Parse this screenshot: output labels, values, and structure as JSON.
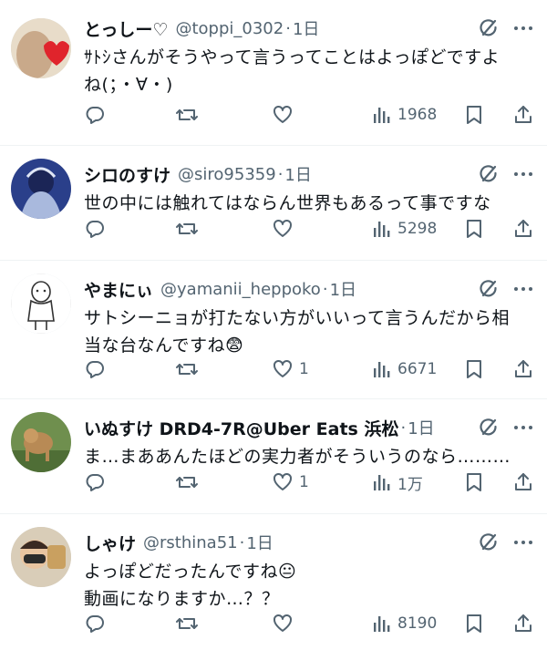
{
  "replies": [
    {
      "name": "とっしー♡",
      "handle": "@toppi_0302",
      "time": "1日",
      "text": "ｻﾄｼさんがそうやって言うってことはよっぽどですよ\nね(；・∀・)",
      "likes": "",
      "views": "1968"
    },
    {
      "name": "シロのすけ",
      "handle": "@siro95359",
      "time": "1日",
      "text": "世の中には触れてはならん世界もあるって事ですな",
      "likes": "",
      "views": "5298"
    },
    {
      "name": "やまにぃ",
      "handle": "@yamanii_heppoko",
      "time": "1日",
      "text": "サトシーニョが打たない方がいいって言うんだから相\n当な台なんですね😨",
      "likes": "1",
      "views": "6671"
    },
    {
      "name": "いぬすけ DRD4-7R@Uber Eats 浜松",
      "handle": "",
      "time": "1日",
      "text": "ま…まああんたほどの実力者がそういうのなら………",
      "likes": "1",
      "views": "1万"
    },
    {
      "name": "しゃけ",
      "handle": "@rsthina51",
      "time": "1日",
      "text": "よっぽどだったんですね😐\n動画になりますか…？？",
      "likes": "",
      "views": "8190"
    }
  ],
  "separator": "·",
  "icons": {
    "header": [
      "grok-icon",
      "more-icon"
    ],
    "actions": [
      "reply-icon",
      "retweet-icon",
      "like-icon",
      "views-icon",
      "bookmark-icon",
      "share-icon"
    ]
  },
  "colors": {
    "text": "#0f1419",
    "secondary": "#536471",
    "divider": "#eff3f4"
  }
}
